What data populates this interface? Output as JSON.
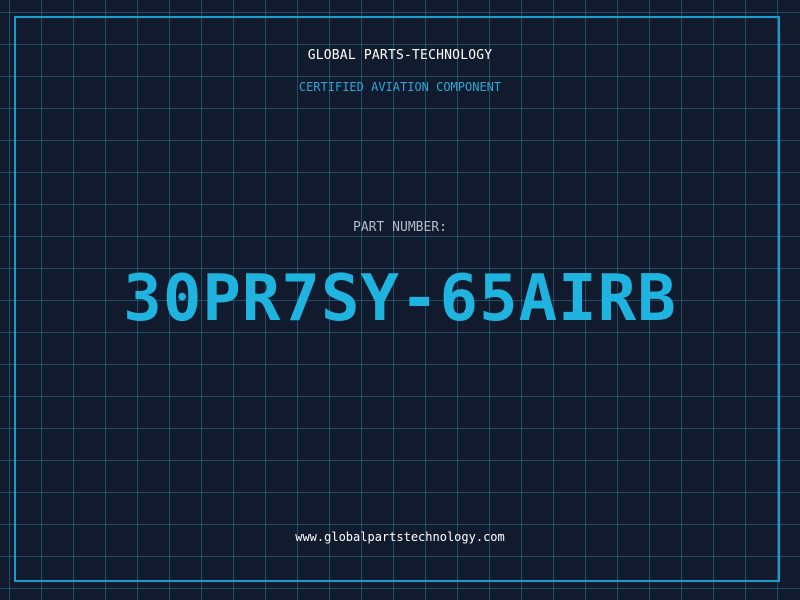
{
  "header": {
    "company": "GLOBAL PARTS-TECHNOLOGY",
    "subtitle": "CERTIFIED AVIATION COMPONENT"
  },
  "part": {
    "label": "PART NUMBER:",
    "number": "30PR7SY-65AIRB"
  },
  "footer": {
    "website": "www.globalpartstechnology.com"
  },
  "colors": {
    "background": "#121a2e",
    "grid": "#26788f",
    "accent": "#1fb3df",
    "frame": "#1a9ccf"
  }
}
